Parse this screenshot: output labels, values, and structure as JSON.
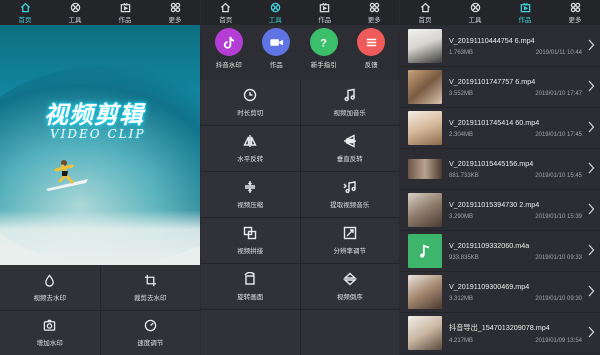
{
  "colors": {
    "accent": "#3fd0dc",
    "bg": "#2f3136"
  },
  "nav": [
    {
      "label": "首页",
      "icon": "home-icon"
    },
    {
      "label": "工具",
      "icon": "tools-icon"
    },
    {
      "label": "作品",
      "icon": "works-icon"
    },
    {
      "label": "更多",
      "icon": "more-icon"
    }
  ],
  "panel1": {
    "hero_title": "视频剪辑",
    "hero_sub": "VIDEO CLIP",
    "tools": [
      "视频去水印",
      "裁剪去水印",
      "增加水印",
      "速度调节"
    ]
  },
  "panel2": {
    "top": [
      {
        "label": "抖音水印",
        "icon": "tiktok-icon",
        "color": "#b43dd6"
      },
      {
        "label": "作品",
        "icon": "video-camera-icon",
        "color": "#5e73e4"
      },
      {
        "label": "新手指引",
        "icon": "help-icon",
        "color": "#3cbf6a"
      },
      {
        "label": "反馈",
        "icon": "feedback-icon",
        "color": "#ef5a5a"
      }
    ],
    "tools": [
      "时长剪切",
      "视频加音乐",
      "水平反转",
      "垂直反转",
      "视频压缩",
      "提取视频音乐",
      "视频拼接",
      "分辨率调节",
      "旋转画面",
      "视频倒序"
    ]
  },
  "panel3": {
    "files": [
      {
        "name": "V_20191110444754 6.mp4",
        "size": "1.763MB",
        "date": "2019/01/11 10:44"
      },
      {
        "name": "V_20191101747757 6.mp4",
        "size": "3.552MB",
        "date": "2019/01/10 17:47"
      },
      {
        "name": "V_20191101745414 60.mp4",
        "size": "2.304MB",
        "date": "2019/01/10 17:45"
      },
      {
        "name": "V_201911015445156.mp4",
        "size": "881.733KB",
        "date": "2019/01/10 15:45"
      },
      {
        "name": "V_201911015394730 2.mp4",
        "size": "3.290MB",
        "date": "2019/01/10 15:39"
      },
      {
        "name": "V_20191109332060.m4a",
        "size": "933.835KB",
        "date": "2019/01/10 09:33"
      },
      {
        "name": "V_20191109300469.mp4",
        "size": "3.312MB",
        "date": "2019/01/10 09:30"
      },
      {
        "name": "抖音导出_1547013209078.mp4",
        "size": "4.217MB",
        "date": "2019/01/09 13:54"
      }
    ]
  }
}
